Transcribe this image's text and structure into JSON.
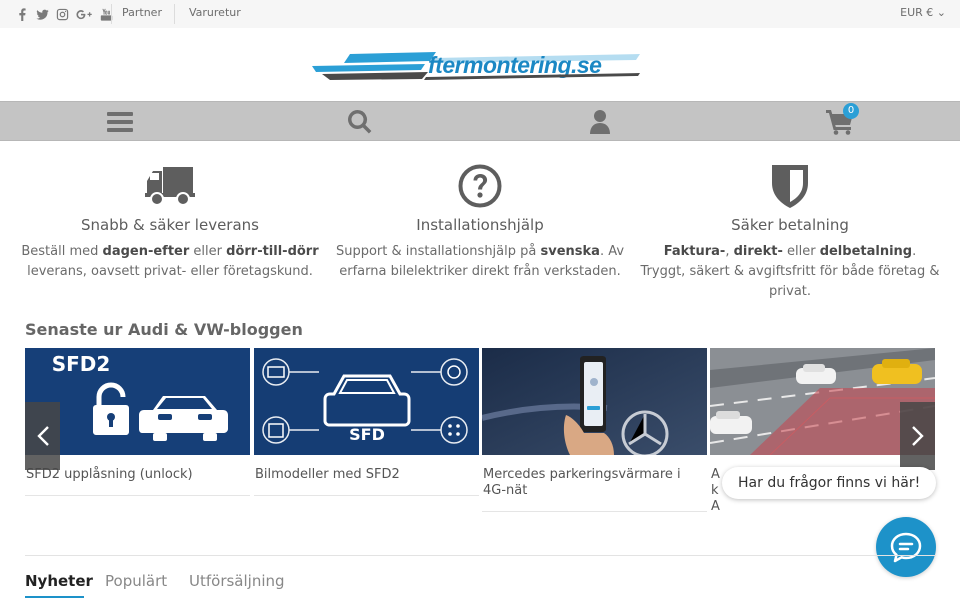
{
  "topbar": {
    "social_icons": [
      "facebook-icon",
      "twitter-icon",
      "instagram-icon",
      "google-plus-icon",
      "youtube-icon"
    ],
    "links": [
      "Partner",
      "Varuretur"
    ],
    "currency": "EUR € ⌄"
  },
  "logo": {
    "text": "Eftermontering.se"
  },
  "nav": {
    "icons": [
      "menu-icon",
      "search-icon",
      "user-icon",
      "cart-icon"
    ],
    "cart_count": "0"
  },
  "features": [
    {
      "icon": "truck-icon",
      "title": "Snabb & säker leverans",
      "text": [
        "Beställ med ",
        "dagen-efter",
        " eller ",
        "dörr-till-dörr",
        " leverans, oavsett privat- eller företagskund."
      ]
    },
    {
      "icon": "question-icon",
      "title": "Installationshjälp",
      "text": [
        "Support & installationshjälp på ",
        "svenska",
        ". Av erfarna bilelektriker direkt från verkstaden."
      ]
    },
    {
      "icon": "shield-icon",
      "title": "Säker betalning",
      "text": [
        "Faktura-",
        ", ",
        "direkt-",
        " eller ",
        "delbetalning",
        ". Tryggt, säkert & avgiftsfritt för både företag & privat."
      ]
    }
  ],
  "blog": {
    "title": "Senaste ur Audi & VW-bloggen",
    "posts": [
      {
        "caption": "SFD2 upplåsning (unlock)",
        "image_label": "SFD2"
      },
      {
        "caption": "Bilmodeller med SFD2",
        "image_label": "SFD"
      },
      {
        "caption": "Mercedes parkeringsvärmare i 4G-nät",
        "image_label": ""
      },
      {
        "caption": "Ak Au",
        "image_label": ""
      }
    ]
  },
  "chat": {
    "bubble": "Har du frågor finns vi här!"
  },
  "tabs": {
    "items": [
      "Nyheter",
      "Populärt",
      "Utförsäljning"
    ],
    "active": "Nyheter"
  },
  "colors": {
    "accent": "#1d92c9",
    "nav_bg": "#c4c4c4",
    "blog_blue": "#15407a"
  }
}
